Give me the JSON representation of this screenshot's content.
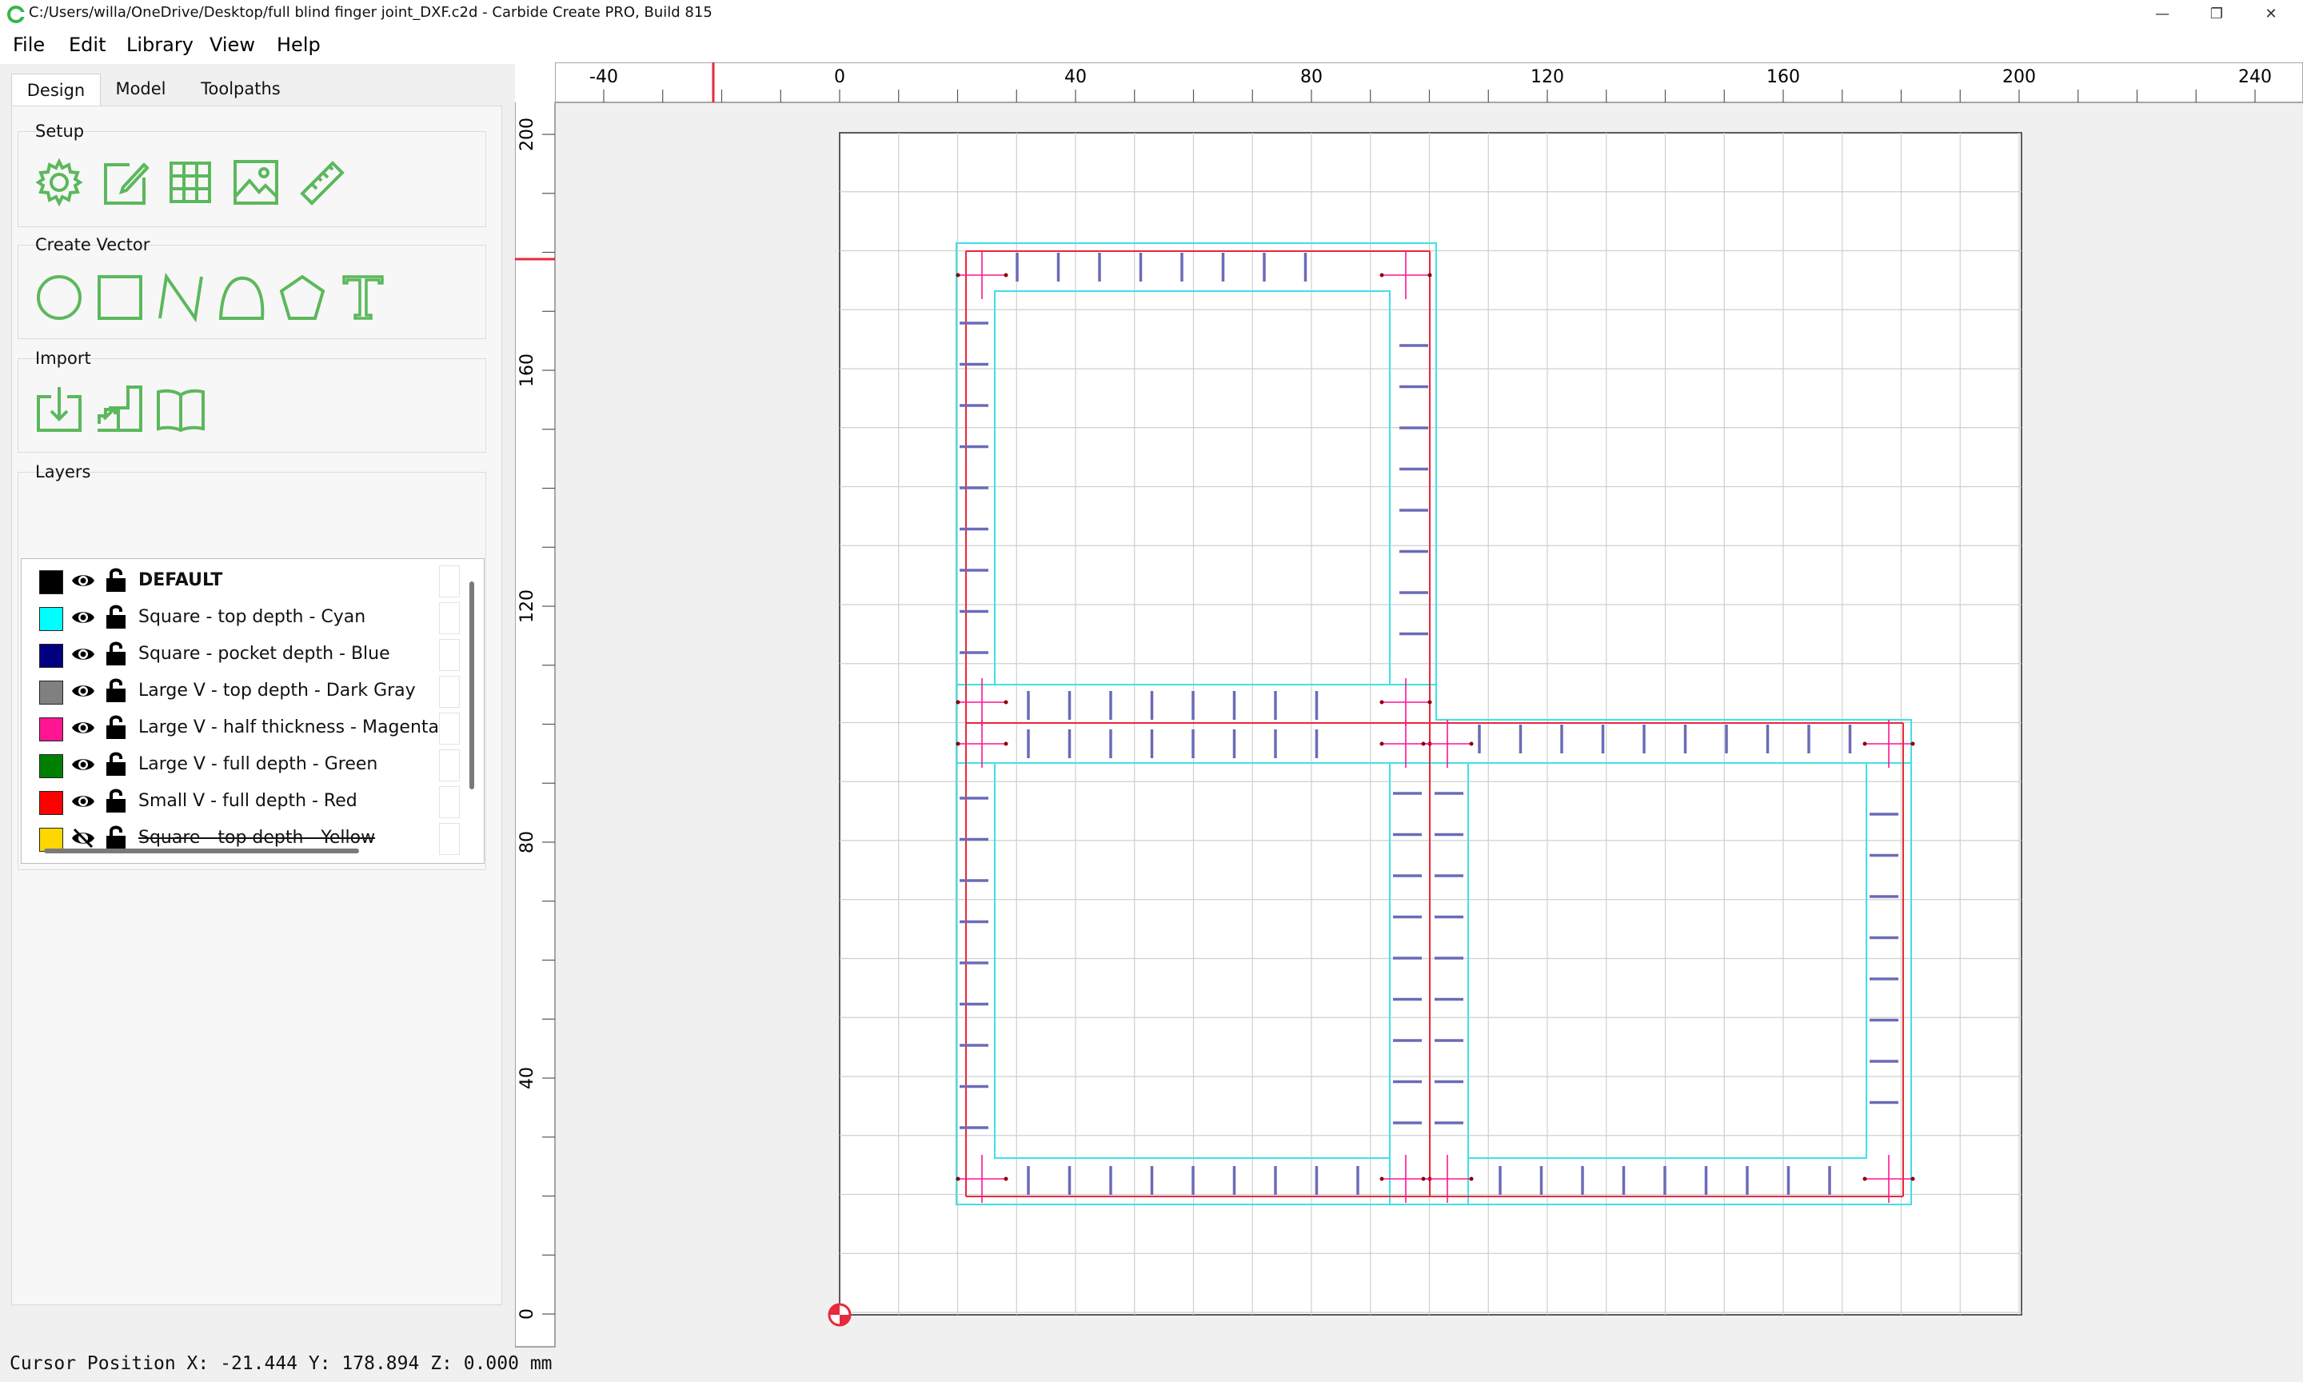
{
  "window": {
    "title": "C:/Users/willa/OneDrive/Desktop/full blind finger joint_DXF.c2d - Carbide Create PRO, Build 815",
    "controls": {
      "minimize": "—",
      "maximize": "❐",
      "close": "✕"
    }
  },
  "menubar": {
    "items": [
      {
        "label": "File"
      },
      {
        "label": "Edit"
      },
      {
        "label": "Library"
      },
      {
        "label": "View"
      },
      {
        "label": "Help"
      }
    ]
  },
  "tabs": {
    "design": "Design",
    "model": "Model",
    "toolpaths": "Toolpaths"
  },
  "panel": {
    "setup_title": "Setup",
    "create_vector_title": "Create Vector",
    "import_title": "Import",
    "layers_title": "Layers",
    "setup_tools": [
      "gear-icon",
      "edit-document-icon",
      "grid-icon",
      "image-icon",
      "ruler-icon"
    ],
    "vector_tools": [
      "circle-icon",
      "rectangle-icon",
      "polyline-icon",
      "curve-icon",
      "polygon-icon",
      "text-icon"
    ],
    "import_tools": [
      "import-file-icon",
      "import-stairs-icon",
      "library-book-icon"
    ]
  },
  "layers": [
    {
      "label": "DEFAULT",
      "color": "#000000",
      "visible": true,
      "bold": true
    },
    {
      "label": "Square - top depth - Cyan",
      "color": "#00ffff",
      "visible": true,
      "bold": false
    },
    {
      "label": "Square - pocket depth - Blue",
      "color": "#000080",
      "visible": true,
      "bold": false
    },
    {
      "label": "Large V - top depth - Dark Gray",
      "color": "#808080",
      "visible": true,
      "bold": false
    },
    {
      "label": "Large V - half thickness - Magenta",
      "color": "#ff1493",
      "visible": true,
      "bold": false
    },
    {
      "label": "Large V - full depth - Green",
      "color": "#008000",
      "visible": true,
      "bold": false
    },
    {
      "label": "Small V - full depth - Red",
      "color": "#ff0000",
      "visible": true,
      "bold": false
    },
    {
      "label": "Square - top depth - Yellow",
      "color": "#ffd700",
      "visible": false,
      "bold": false
    }
  ],
  "rulers": {
    "x_labels": [
      "-40",
      "0",
      "40",
      "80",
      "120",
      "160",
      "200",
      "240"
    ],
    "y_labels": [
      "200",
      "160",
      "120",
      "80",
      "40",
      "0"
    ]
  },
  "status": {
    "cursor_text": "Cursor Position X: -21.444 Y: 178.894 Z: 0.000 mm"
  },
  "colors": {
    "accent_green": "#5cb85c",
    "outline_cyan": "#40e0e8",
    "cut_red": "#e8283c",
    "pocket_blue": "#6b6bb8",
    "cross_magenta": "#ff1493"
  }
}
